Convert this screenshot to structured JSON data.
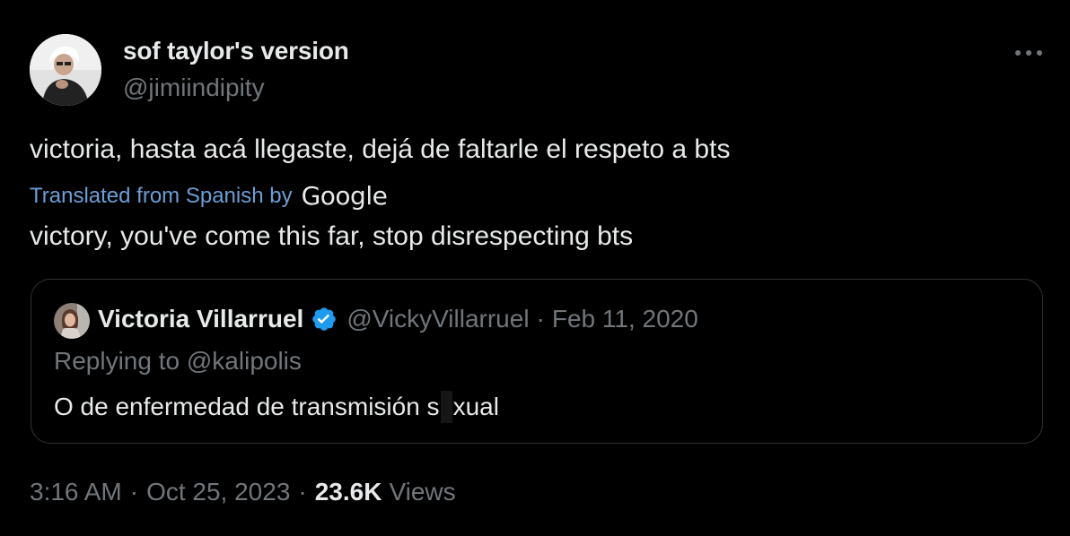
{
  "tweet": {
    "author": {
      "display_name": "sof taylor's version",
      "handle": "@jimiindipity",
      "avatar_icon": "user-avatar"
    },
    "more_icon": "more-horizontal-icon",
    "text": "victoria, hasta acá llegaste, dejá de faltarle el respeto a bts",
    "translation": {
      "label": "Translated from Spanish by",
      "provider": "Google",
      "text": "victory, you've come this far, stop disrespecting bts"
    },
    "quote": {
      "name": "Victoria Villarruel",
      "verified_icon": "verified-badge-icon",
      "handle": "@VickyVillarruel",
      "separator": "·",
      "date": "Feb 11, 2020",
      "replying_to_prefix": "Replying to",
      "replying_to_handle": "@kalipolis",
      "text_before": "O de enfermedad de transmisión s",
      "text_after": "xual"
    },
    "meta": {
      "time": "3:16 AM",
      "separator": "·",
      "date": "Oct 25, 2023",
      "views_count": "23.6K",
      "views_label": "Views"
    }
  },
  "colors": {
    "background": "#000000",
    "primary_text": "#e7e9ea",
    "secondary_text": "#71767b",
    "link": "#6a9fd8",
    "border": "#2f3336",
    "verified": "#1d9bf0"
  }
}
